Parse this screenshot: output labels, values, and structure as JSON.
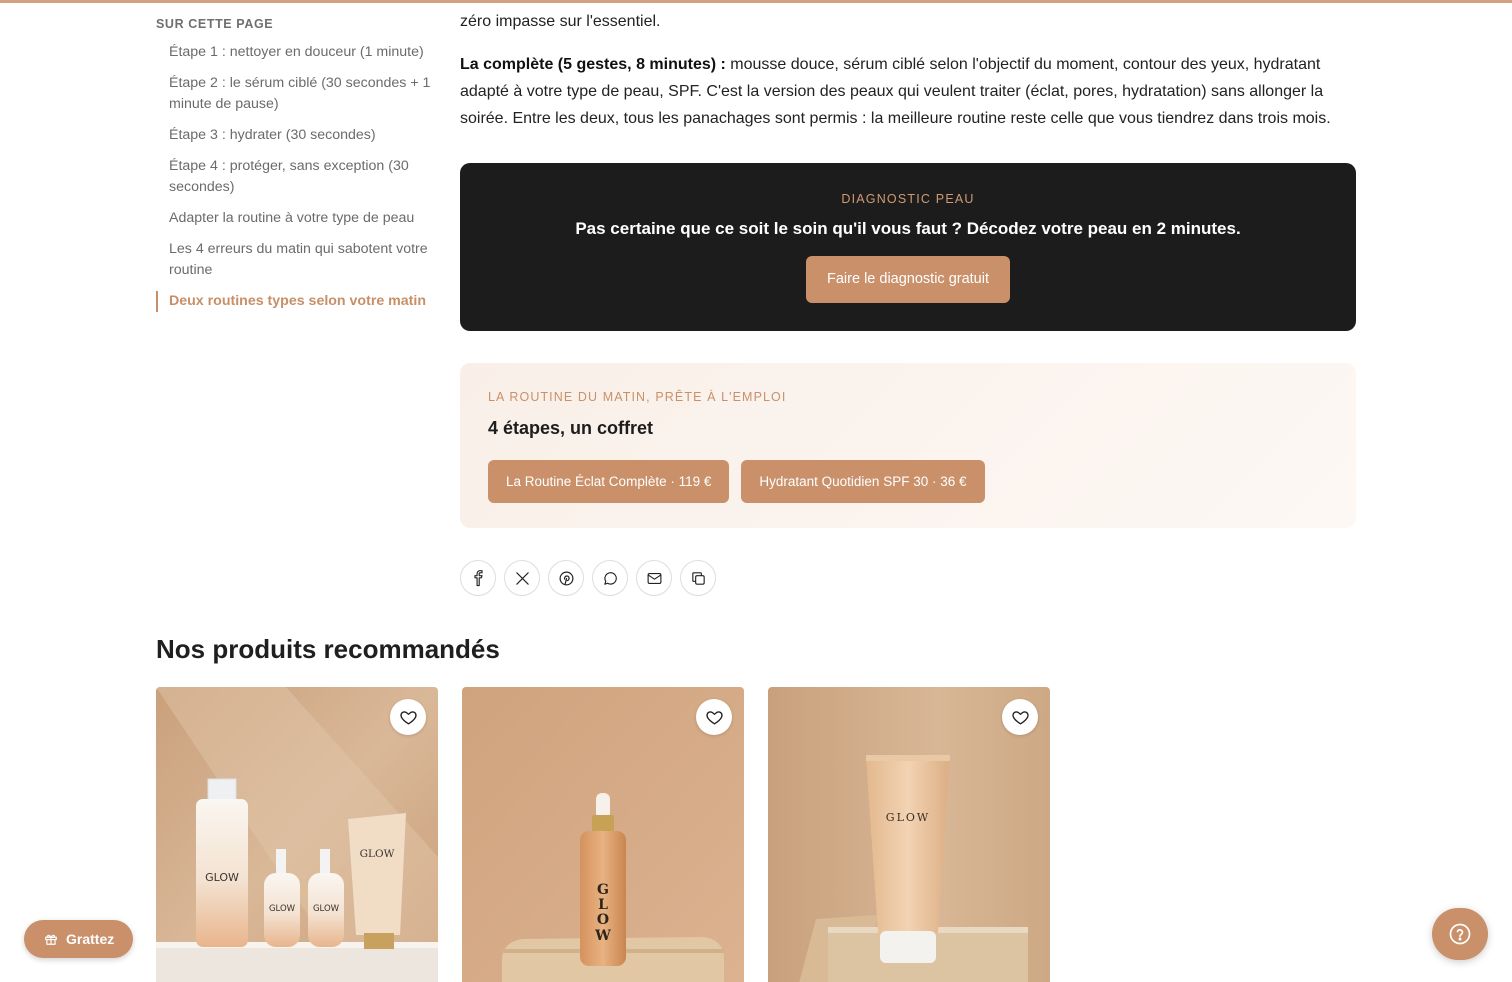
{
  "theme": {
    "accent": "#c9906a",
    "dark_panel": "#1c1c1c",
    "progress_bar": "#d3a182"
  },
  "toc": {
    "title": "SUR CETTE PAGE",
    "items": [
      {
        "label": "Étape 1 : nettoyer en douceur (1 minute)",
        "active": false
      },
      {
        "label": "Étape 2 : le sérum ciblé (30 secondes + 1 minute de pause)",
        "active": false
      },
      {
        "label": "Étape 3 : hydrater (30 secondes)",
        "active": false
      },
      {
        "label": "Étape 4 : protéger, sans exception (30 secondes)",
        "active": false
      },
      {
        "label": "Adapter la routine à votre type de peau",
        "active": false
      },
      {
        "label": "Les 4 erreurs du matin qui sabotent votre routine",
        "active": false
      },
      {
        "label": "Deux routines types selon votre matin",
        "active": true
      }
    ]
  },
  "article": {
    "para1": "zéro impasse sur l'essentiel.",
    "para2_bold": "La complète (5 gestes, 8 minutes) :",
    "para2_text": " mousse douce, sérum ciblé selon l'objectif du moment, contour des yeux, hydratant adapté à votre type de peau, SPF. C'est la version des peaux qui veulent traiter (éclat, pores, hydratation) sans allonger la soirée. Entre les deux, tous les panachages sont permis : la meilleure routine reste celle que vous tiendrez dans trois mois."
  },
  "diagnostic": {
    "eyebrow": "DIAGNOSTIC PEAU",
    "title": "Pas certaine que ce soit le soin qu'il vous faut ? Décodez votre peau en 2 minutes.",
    "button": "Faire le diagnostic gratuit"
  },
  "kit": {
    "eyebrow": "LA ROUTINE DU MATIN, PRÊTE À L'EMPLOI",
    "title": "4 étapes, un coffret",
    "buttons": [
      "La Routine Éclat Complète · 119 €",
      "Hydratant Quotidien SPF 30 · 36 €"
    ]
  },
  "share": {
    "icons": [
      "facebook-icon",
      "x-icon",
      "pinterest-icon",
      "whatsapp-icon",
      "email-icon",
      "copy-link-icon"
    ]
  },
  "recommended": {
    "title": "Nos produits recommandés",
    "cards": [
      {
        "image": "routine-kit-photo",
        "brand": "GLOW"
      },
      {
        "image": "serum-bottle-photo",
        "brand": "GLOW"
      },
      {
        "image": "cream-tube-photo",
        "brand": "GLOW"
      }
    ]
  },
  "floating": {
    "scratch_label": "Grattez",
    "help_icon": "help-icon"
  }
}
